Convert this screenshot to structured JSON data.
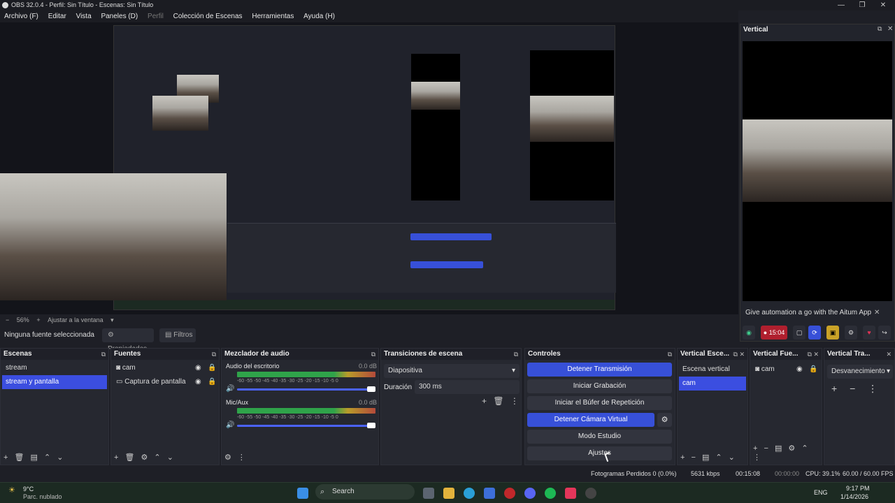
{
  "window": {
    "title": "OBS 32.0.4 - Perfil: Sin Título - Escenas: Sin Título",
    "min": "—",
    "max": "❐",
    "close": "✕"
  },
  "menu": [
    "Archivo (F)",
    "Editar",
    "Vista",
    "Paneles (D)",
    "Perfil",
    "Colección de Escenas",
    "Herramientas",
    "Ayuda (H)"
  ],
  "zoom": {
    "value": "56%",
    "fit": "Ajustar a la ventana"
  },
  "vertical": {
    "title": "Vertical",
    "notification": "Give automation a go with the Aitum App",
    "timer": "15:04"
  },
  "sourcebar": {
    "none": "Ninguna fuente seleccionada",
    "properties": "Propiedades",
    "filters": "Filtros"
  },
  "scenes": {
    "title": "Escenas",
    "items": [
      "stream",
      "stream y pantalla"
    ]
  },
  "sources": {
    "title": "Fuentes",
    "items": [
      "cam",
      "Captura de pantalla"
    ]
  },
  "mixer": {
    "title": "Mezclador de audio",
    "channels": [
      {
        "name": "Audio del escritorio",
        "db": "0.0 dB"
      },
      {
        "name": "Mic/Aux",
        "db": "0.0 dB"
      }
    ],
    "ticks": "-60 -55 -50 -45 -40 -35 -30 -25 -20 -15 -10 -5 0"
  },
  "transitions": {
    "title": "Transiciones de escena",
    "selected": "Diapositiva",
    "duration_label": "Duración",
    "duration": "300 ms"
  },
  "controls": {
    "title": "Controles",
    "buttons": [
      "Detener Transmisión",
      "Iniciar Grabación",
      "Iniciar el Búfer de Repetición",
      "Detener Cámara Virtual",
      "Modo Estudio",
      "Ajustes"
    ]
  },
  "vscenes": {
    "title": "Vertical Esce...",
    "items": [
      "Escena vertical",
      "cam"
    ]
  },
  "vsources": {
    "title": "Vertical Fue...",
    "items": [
      "cam"
    ]
  },
  "vtransitions": {
    "title": "Vertical Tra...",
    "selected": "Desvanecimiento"
  },
  "status": {
    "dropped": "Fotogramas Perdidos 0 (0.0%)",
    "kbps": "5631 kbps",
    "stream_time": "00:15:08",
    "rec_time": "00:00:00",
    "cpu": "CPU: 39.1%",
    "fps": "60.00 / 60.00 FPS"
  },
  "taskbar": {
    "temp": "9°C",
    "weather": "Parc. nublado",
    "search": "Search",
    "lang": "ENG",
    "time": "9:17 PM",
    "date": "1/14/2026"
  },
  "colors": {
    "accent": "#3b4ee0",
    "bg": "#1e1f26",
    "panel": "#262830"
  }
}
